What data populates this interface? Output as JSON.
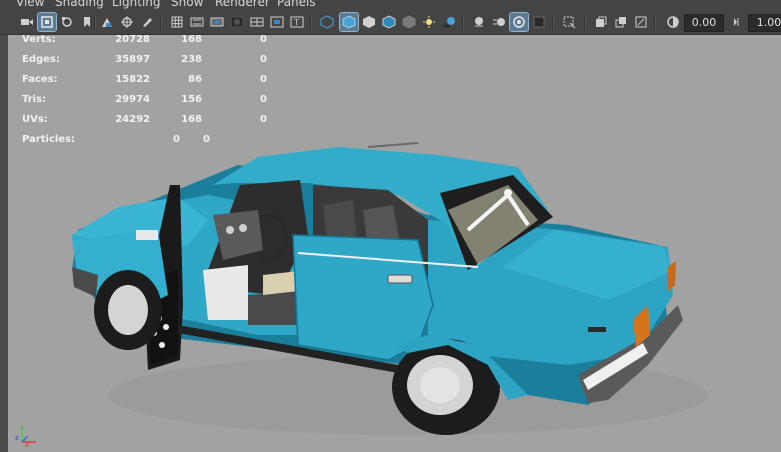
{
  "menu": {
    "view": "View",
    "shading": "Shading",
    "lighting": "Lighting",
    "show": "Show",
    "renderer": "Renderer",
    "panels": "Panels"
  },
  "toolbar": {
    "exposure_value": "0.00",
    "gamma_value": "1.00",
    "icons": [
      "camera-icon",
      "camera-attributes-icon",
      "bookmark-icon",
      "image-plane-icon",
      "grid-icon",
      "film-gate-icon",
      "resolution-gate-icon",
      "gate-mask-icon",
      "field-chart-icon",
      "safe-action-icon",
      "safe-title-icon",
      "wireframe-icon",
      "smooth-shade-icon",
      "xray-icon",
      "wireframe-on-shaded-icon",
      "use-all-lights-icon",
      "shadows-icon",
      "screen-space-ao-icon",
      "motion-blur-icon",
      "anti-aliasing-icon",
      "depth-of-field-icon",
      "isolate-select-icon",
      "xray-joints-icon",
      "xray-active-icon",
      "backface-culling-icon",
      "exposure-icon",
      "gamma-icon"
    ]
  },
  "hud": {
    "rows": [
      {
        "label": "Verts:",
        "c1": "20728",
        "c2": "168",
        "c3": "0"
      },
      {
        "label": "Edges:",
        "c1": "35897",
        "c2": "238",
        "c3": "0"
      },
      {
        "label": "Faces:",
        "c1": "15822",
        "c2": "86",
        "c3": "0"
      },
      {
        "label": "Tris:",
        "c1": "29974",
        "c2": "156",
        "c3": "0"
      },
      {
        "label": "UVs:",
        "c1": "24292",
        "c2": "168",
        "c3": "0"
      }
    ],
    "particles": {
      "label": "Particles:",
      "v1": "0",
      "v2": "0"
    }
  },
  "colors": {
    "viewport_bg": "#a2a2a2",
    "car_body": "#2fa7c6",
    "car_shadow": "#1b7f9c",
    "toolbar_bg": "#444444",
    "active_button": "#5d7a93"
  },
  "axis": {
    "z": "z",
    "x": "x"
  }
}
